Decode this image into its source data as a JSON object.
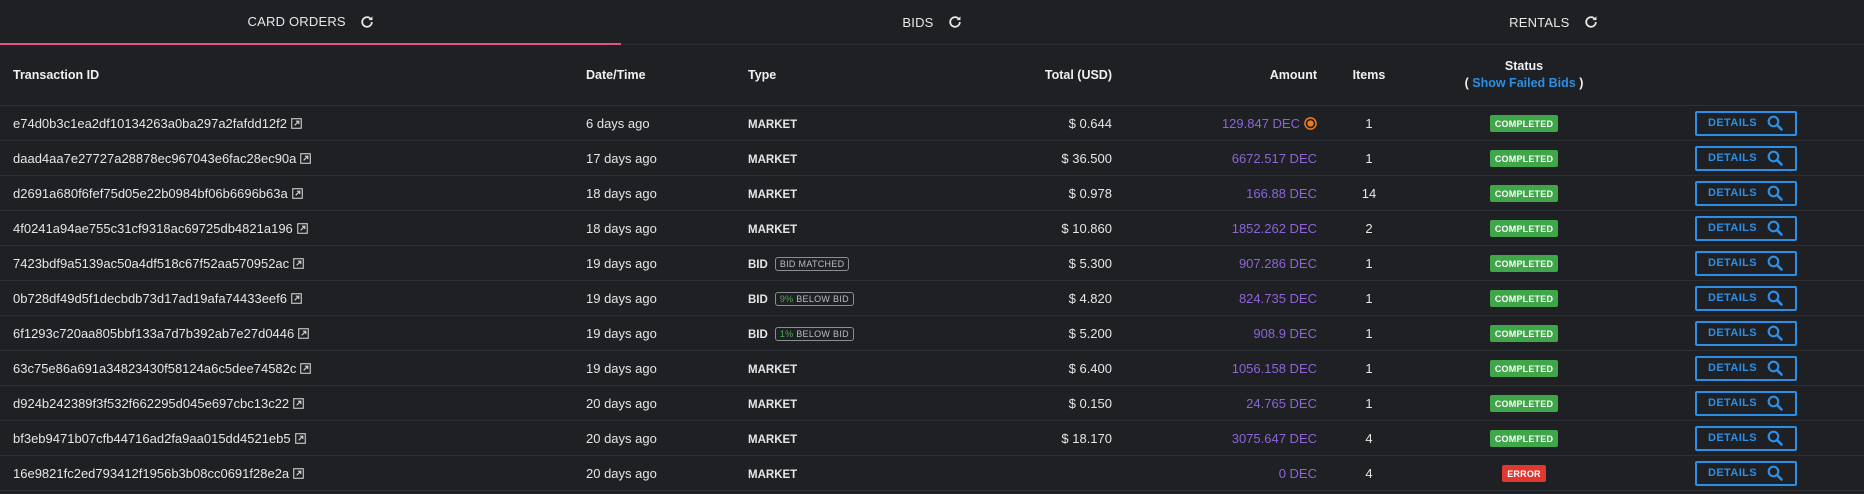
{
  "tabs": [
    {
      "label": "CARD ORDERS",
      "active": true
    },
    {
      "label": "BIDS",
      "active": false
    },
    {
      "label": "RENTALS",
      "active": false
    }
  ],
  "columns": {
    "tx": "Transaction ID",
    "date": "Date/Time",
    "type": "Type",
    "total": "Total (USD)",
    "amount": "Amount",
    "items": "Items",
    "status": "Status",
    "status_link_prefix": "(",
    "status_link": "Show Failed Bids",
    "status_link_suffix": ")"
  },
  "details_label": "DETAILS",
  "colors": {
    "accent": "#2b8fe8",
    "amount": "#8e64d8",
    "completed": "#3fa64a",
    "error": "#e0382f",
    "tab_underline": "#e0557f"
  },
  "rows": [
    {
      "tx": "e74d0b3c1ea2df10134263a0ba297a2fafdd12f2",
      "date": "6 days ago",
      "type": "MARKET",
      "tag_pct": "",
      "tag_text": "",
      "total": "$ 0.644",
      "amount": "129.847 DEC",
      "coin": true,
      "items": "1",
      "status": "COMPLETED"
    },
    {
      "tx": "daad4aa7e27727a28878ec967043e6fac28ec90a",
      "date": "17 days ago",
      "type": "MARKET",
      "tag_pct": "",
      "tag_text": "",
      "total": "$ 36.500",
      "amount": "6672.517 DEC",
      "coin": false,
      "items": "1",
      "status": "COMPLETED"
    },
    {
      "tx": "d2691a680f6fef75d05e22b0984bf06b6696b63a",
      "date": "18 days ago",
      "type": "MARKET",
      "tag_pct": "",
      "tag_text": "",
      "total": "$ 0.978",
      "amount": "166.88 DEC",
      "coin": false,
      "items": "14",
      "status": "COMPLETED"
    },
    {
      "tx": "4f0241a94ae755c31cf9318ac69725db4821a196",
      "date": "18 days ago",
      "type": "MARKET",
      "tag_pct": "",
      "tag_text": "",
      "total": "$ 10.860",
      "amount": "1852.262 DEC",
      "coin": false,
      "items": "2",
      "status": "COMPLETED"
    },
    {
      "tx": "7423bdf9a5139ac50a4df518c67f52aa570952ac",
      "date": "19 days ago",
      "type": "BID",
      "tag_pct": "",
      "tag_text": "BID MATCHED",
      "total": "$ 5.300",
      "amount": "907.286 DEC",
      "coin": false,
      "items": "1",
      "status": "COMPLETED"
    },
    {
      "tx": "0b728df49d5f1decbdb73d17ad19afa74433eef6",
      "date": "19 days ago",
      "type": "BID",
      "tag_pct": "9%",
      "tag_text": " BELOW BID",
      "total": "$ 4.820",
      "amount": "824.735 DEC",
      "coin": false,
      "items": "1",
      "status": "COMPLETED"
    },
    {
      "tx": "6f1293c720aa805bbf133a7d7b392ab7e27d0446",
      "date": "19 days ago",
      "type": "BID",
      "tag_pct": "1%",
      "tag_text": " BELOW BID",
      "total": "$ 5.200",
      "amount": "908.9 DEC",
      "coin": false,
      "items": "1",
      "status": "COMPLETED"
    },
    {
      "tx": "63c75e86a691a34823430f58124a6c5dee74582c",
      "date": "19 days ago",
      "type": "MARKET",
      "tag_pct": "",
      "tag_text": "",
      "total": "$ 6.400",
      "amount": "1056.158 DEC",
      "coin": false,
      "items": "1",
      "status": "COMPLETED"
    },
    {
      "tx": "d924b242389f3f532f662295d045e697cbc13c22",
      "date": "20 days ago",
      "type": "MARKET",
      "tag_pct": "",
      "tag_text": "",
      "total": "$ 0.150",
      "amount": "24.765 DEC",
      "coin": false,
      "items": "1",
      "status": "COMPLETED"
    },
    {
      "tx": "bf3eb9471b07cfb44716ad2fa9aa015dd4521eb5",
      "date": "20 days ago",
      "type": "MARKET",
      "tag_pct": "",
      "tag_text": "",
      "total": "$ 18.170",
      "amount": "3075.647 DEC",
      "coin": false,
      "items": "4",
      "status": "COMPLETED"
    },
    {
      "tx": "16e9821fc2ed793412f1956b3b08cc0691f28e2a",
      "date": "20 days ago",
      "type": "MARKET",
      "tag_pct": "",
      "tag_text": "",
      "total": "",
      "amount": "0 DEC",
      "coin": false,
      "items": "4",
      "status": "ERROR"
    }
  ]
}
